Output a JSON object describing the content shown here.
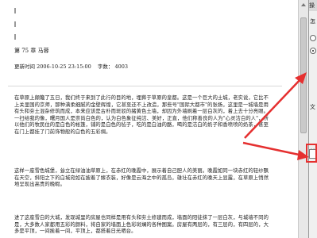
{
  "chapter": {
    "title": "第 75 章  马蓉"
  },
  "meta": {
    "updated_label": "更新时间",
    "updated_value": "2006-10-25 23:15:00",
    "words_label": "字数：",
    "words_value": "4003"
  },
  "body": {
    "paragraphs": [
      "在草原上颠簸了五日，我们终于来到了此行的目的地，埋葬于草原的皇都。这是一个巨大的土城，老实说，它比不上关里国的京师，那种满柔细腻的金壁辉煌，它甚至还不上改造，那些号\"国际大都市\"的张扬，这里是一城墙是用有头和夯土混杂修筑而成，本来应该是古朴而斑驳的赭黄色土墙，却因为外墙刷着一层白灰的，着上去十分亮眼。一扫给我的像，曙月国人是崇尚白色的，认为白色象征纯洁、美好，正直，他们称善良的人为\"心灵洁白的人\"，所以他们的牧民住的是白色的帐篷，铺的是白色的毡子，吃的是白油的酪，喝的是洁白的奶子和香喷喷的奶茶，甚至在门上都挂了门前饰物般的白色的五彩绸。",
      "这样一座雪色城堡，耸立在绿油油草原上，在赤红的晚霞中，展示着自己胆人的美丽。晚霞如同一块赤红的轻纱飘在天空，斜阳之下的白城宛如在披着了嫁衣装，好像是云海之中的孤岛，雄壮在赤红的晚天上显露，在草原上悄然地呈现出高贵的晚暇。",
      "进了这座雪白的大城，发现城里的房屋也同样是用有头和夯土修建而成，墙面的阳徒抹了一层白灰，与城墙不同的是，大多数人家都用五彩的颜料，将自家的墙面上色彩斑斓的各种图案。房屋有两层的，有三层的，有四层的，大多是平顶，一间挨着一间，平顶上，都搭着日光晒台。"
    ]
  },
  "panel": {
    "header": "操",
    "labels": [
      "怎",
      "文",
      "其"
    ]
  },
  "colors": {
    "annotation": "#e53030"
  }
}
